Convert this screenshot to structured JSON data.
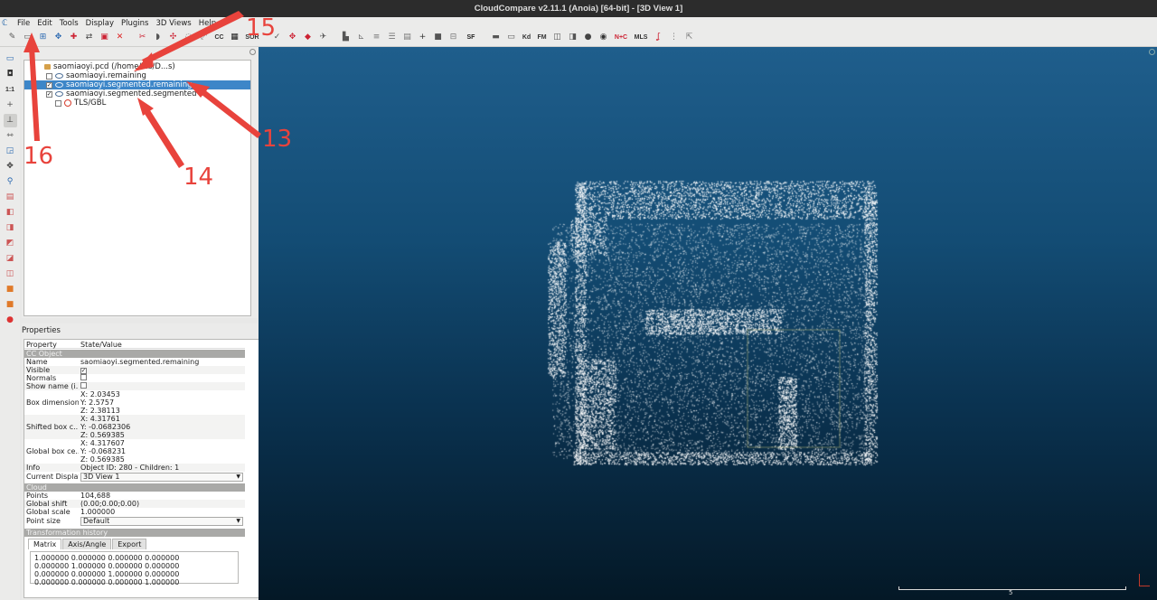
{
  "window": {
    "title": "CloudCompare v2.11.1 (Anoia) [64-bit] - [3D View 1]"
  },
  "menu": [
    "File",
    "Edit",
    "Tools",
    "Display",
    "Plugins",
    "3D Views",
    "Help"
  ],
  "toolbar": {
    "sf_label": "SF",
    "sor_label": "SOR",
    "kd_label": "Kd",
    "fm_label": "FM",
    "nc_label": "N+C",
    "mls_label": "MLS",
    "cc_label": "CC",
    "icons": [
      "open-icon",
      "save-icon",
      "clone-icon",
      "merge-icon",
      "subsample-icon",
      "translate-icon",
      "sample-icon",
      "delete-icon",
      "segment-icon",
      "cross-section-icon",
      "point-pick-icon",
      "sf-icon",
      "noise-icon",
      "normal-icon",
      "histogram-icon",
      "plus-icon",
      "minus-icon",
      "scale-icon",
      "mls-icon"
    ]
  },
  "db_tree": {
    "items": [
      {
        "label": "saomiaoyi.pcd (/home/lds/D...s)",
        "type": "file",
        "checked": null,
        "depth": 0
      },
      {
        "label": "saomiaoyi.remaining",
        "type": "cloud",
        "checked": false,
        "depth": 1
      },
      {
        "label": "saomiaoyi.segmented.remaining",
        "type": "cloud",
        "checked": true,
        "depth": 1,
        "selected": true
      },
      {
        "label": "saomiaoyi.segmented.segmented",
        "type": "cloud",
        "checked": true,
        "depth": 1
      },
      {
        "label": "TLS/GBL",
        "type": "sensor",
        "checked": false,
        "depth": 2
      }
    ]
  },
  "properties": {
    "title": "Properties",
    "col_property": "Property",
    "col_value": "State/Value",
    "section_cc_object": "CC Object",
    "name_key": "Name",
    "name_val": "saomiaoyi.segmented.remaining",
    "visible_key": "Visible",
    "visible": true,
    "normals_key": "Normals",
    "normals": false,
    "showname_key": "Show name (i...",
    "showname": false,
    "boxdim_key": "Box dimensions",
    "boxdim": [
      "X: 2.03453",
      "Y: 2.5757",
      "Z: 2.38113"
    ],
    "shifted_key": "Shifted box c...",
    "shifted": [
      "X: 4.31761",
      "Y: -0.0682306",
      "Z: 0.569385"
    ],
    "global_key": "Global box ce...",
    "global": [
      "X: 4.317607",
      "Y: -0.068231",
      "Z: 0.569385"
    ],
    "info_key": "Info",
    "info_val": "Object ID: 280 - Children: 1",
    "display_key": "Current Display",
    "display_val": "3D View 1",
    "section_cloud": "Cloud",
    "points_key": "Points",
    "points_val": "104,688",
    "gshift_key": "Global shift",
    "gshift_val": "(0.00;0.00;0.00)",
    "gscale_key": "Global scale",
    "gscale_val": "1.000000",
    "psize_key": "Point size",
    "psize_val": "Default",
    "section_trans": "Transformation history",
    "tabs": [
      "Matrix",
      "Axis/Angle",
      "Export"
    ],
    "matrix": [
      "1.000000 0.000000 0.000000 0.000000",
      "0.000000 1.000000 0.000000 0.000000",
      "0.000000 0.000000 1.000000 0.000000",
      "0.000000 0.000000 0.000000 1.000000"
    ]
  },
  "view3d": {
    "scale_label": "5"
  },
  "annotations": {
    "a13": "13",
    "a14": "14",
    "a15": "15",
    "a16": "16",
    "color": "#e8433c"
  }
}
